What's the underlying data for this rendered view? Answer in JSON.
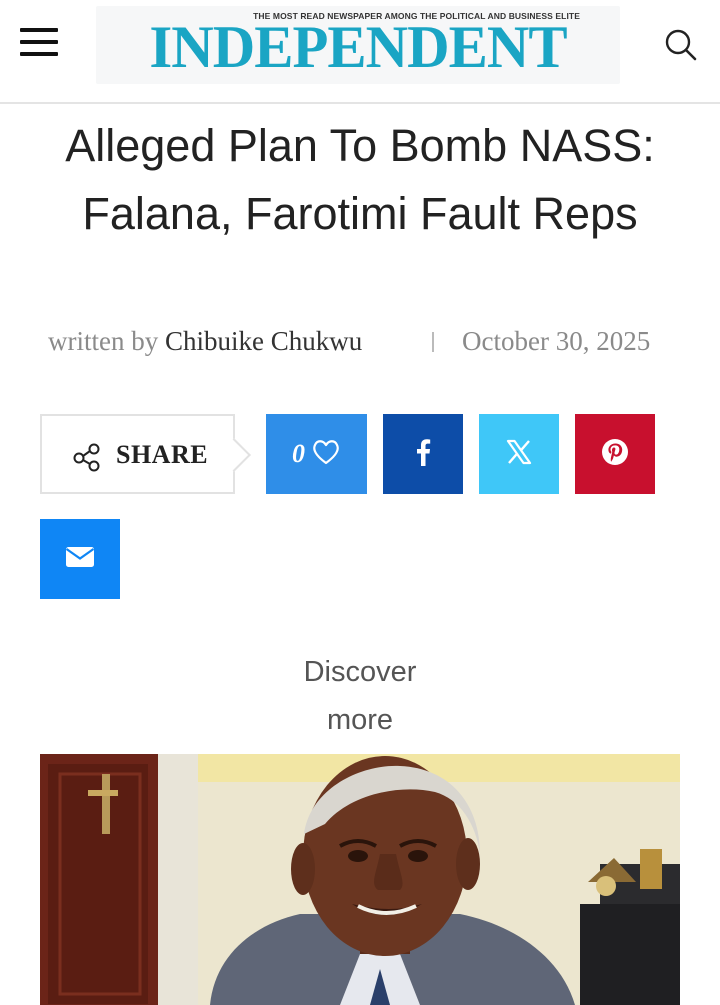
{
  "header": {
    "tagline": "THE MOST READ NEWSPAPER AMONG THE POLITICAL AND BUSINESS ELITE",
    "logo_text": "INDEPENDENT",
    "brand_color": "#1aa5c4",
    "menu_icon": "hamburger-menu-icon",
    "search_icon": "search-icon"
  },
  "article": {
    "title": "Alleged Plan To Bomb NASS: Falana, Farotimi Fault Reps",
    "written_by": "written by",
    "author": "Chibuike Chukwu",
    "date": "October 30, 2025"
  },
  "share": {
    "label": "SHARE",
    "like_count": "0",
    "colors": {
      "like": "#2f8ee8",
      "facebook": "#0d4da8",
      "x": "#3fc7f8",
      "pinterest": "#c8102e",
      "email": "#0f86f5"
    }
  },
  "discover": {
    "line1": "Discover",
    "line2": "more"
  }
}
